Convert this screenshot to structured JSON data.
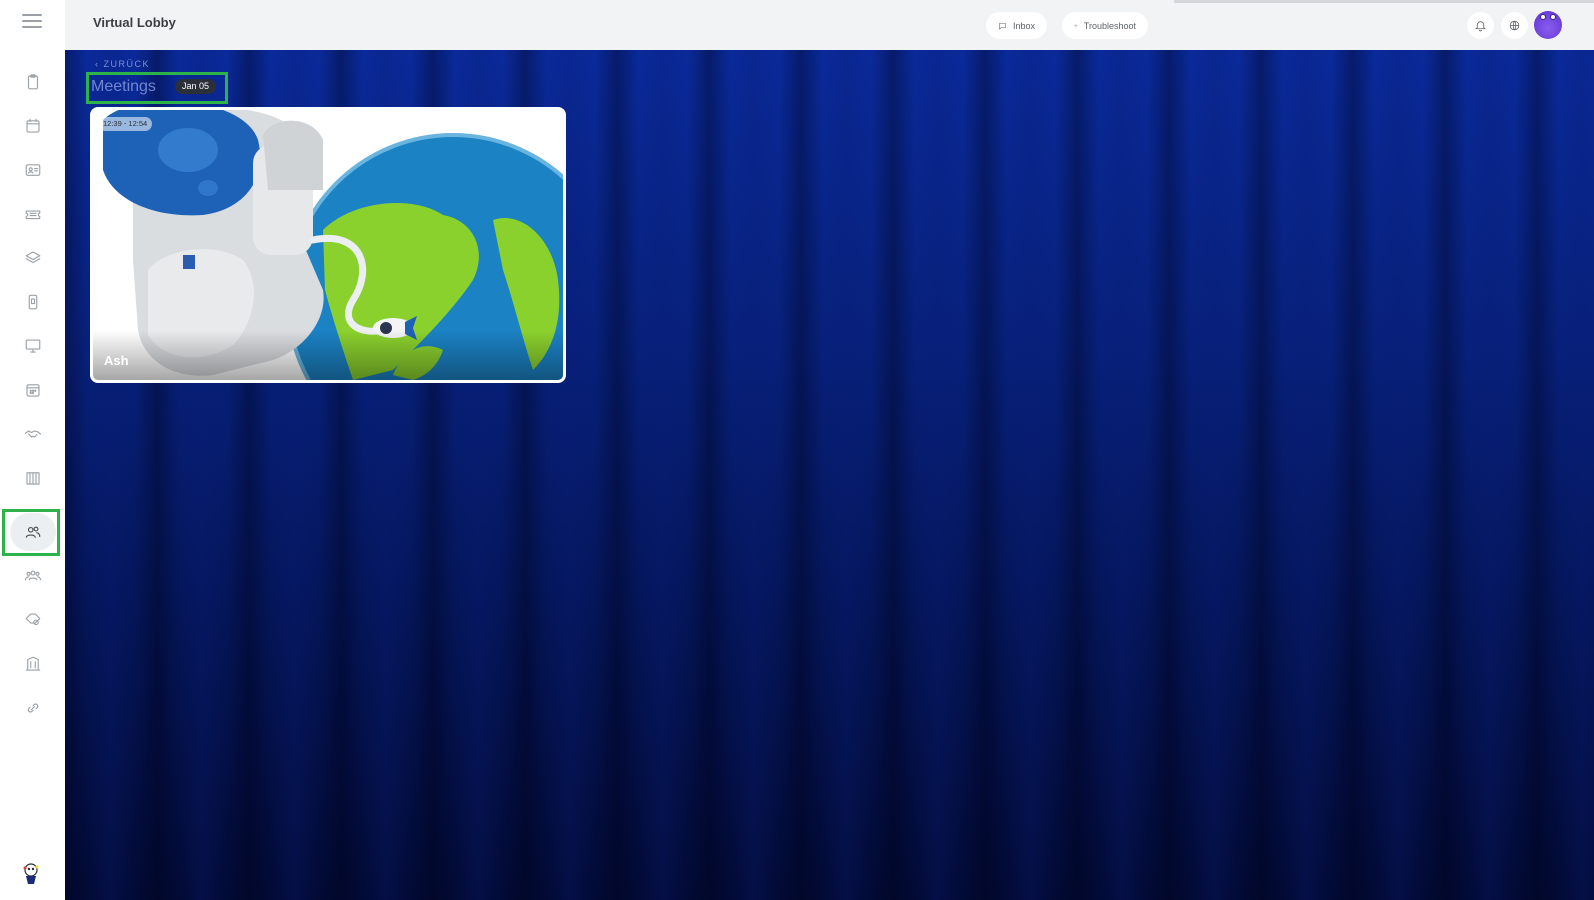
{
  "app": {
    "title": "Virtual Lobby"
  },
  "header": {
    "inbox_label": "Inbox",
    "troubleshoot_label": "Troubleshoot"
  },
  "sidebar": {
    "items": [
      {
        "icon": "clipboard-icon"
      },
      {
        "icon": "calendar-icon"
      },
      {
        "icon": "contact-card-icon"
      },
      {
        "icon": "ticket-icon"
      },
      {
        "icon": "layers-icon"
      },
      {
        "icon": "mobile-icon"
      },
      {
        "icon": "monitor-icon"
      },
      {
        "icon": "schedule-icon"
      },
      {
        "icon": "handshake-icon"
      },
      {
        "icon": "booth-icon"
      },
      {
        "icon": "users-icon",
        "active": true
      },
      {
        "icon": "group-icon"
      },
      {
        "icon": "tags-icon"
      },
      {
        "icon": "building-icon"
      },
      {
        "icon": "link-icon"
      }
    ]
  },
  "main": {
    "back_label": "‹ ZURÜCK",
    "page_title": "Meetings",
    "date_badge": "Jan 05",
    "meetings": [
      {
        "time": "12:39 - 12:54",
        "name": "Ash"
      }
    ]
  },
  "colors": {
    "accent_highlight": "#2db34a",
    "background_blue": "#07207a",
    "avatar_purple": "#6a3fd8"
  }
}
